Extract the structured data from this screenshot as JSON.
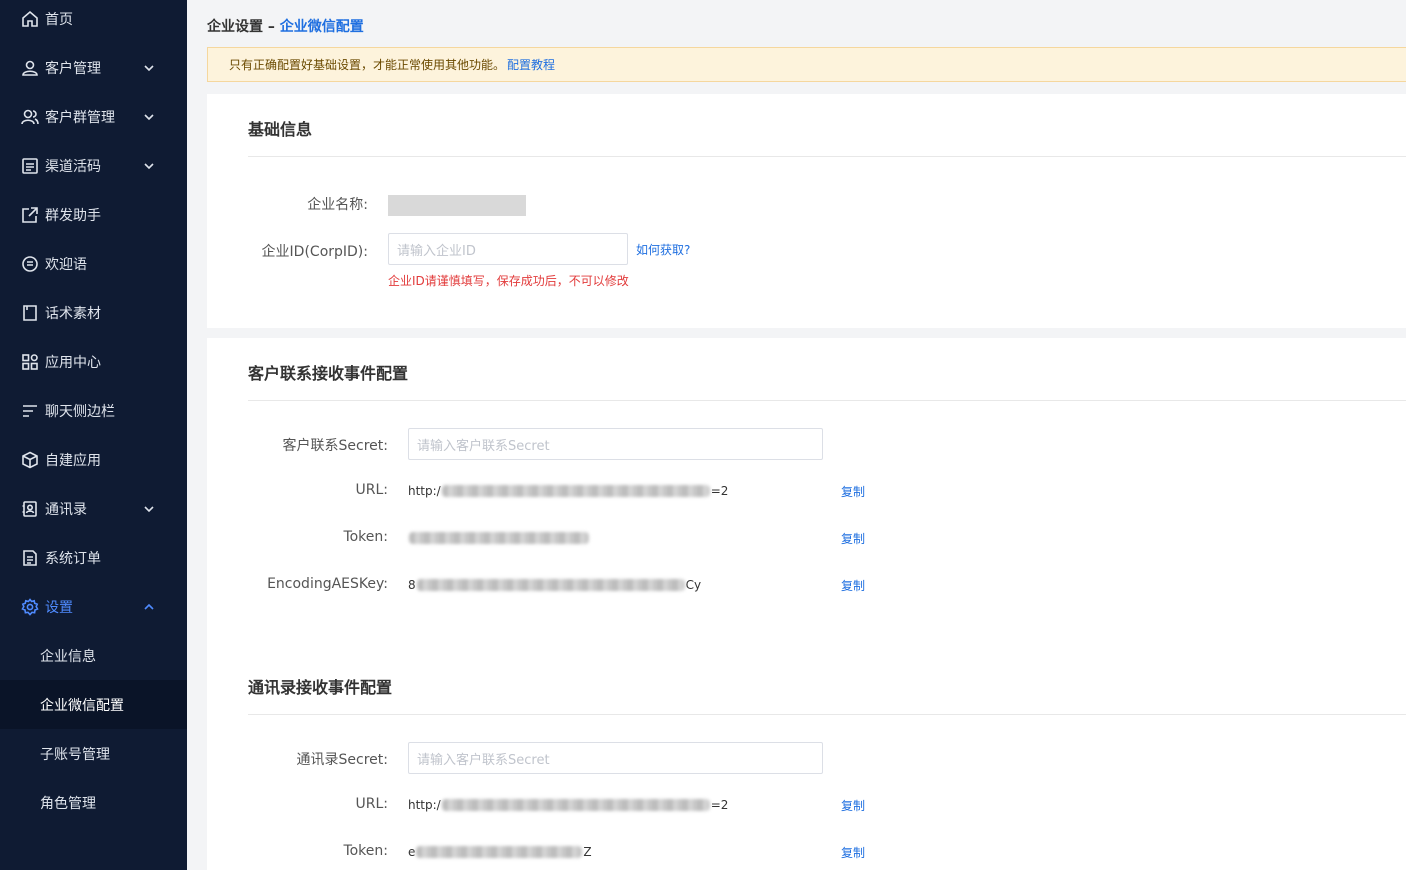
{
  "sidebar": {
    "items": [
      {
        "label": "首页",
        "icon": "home-icon"
      },
      {
        "label": "客户管理",
        "icon": "user-icon"
      },
      {
        "label": "客户群管理",
        "icon": "group-icon"
      },
      {
        "label": "渠道活码",
        "icon": "qrcode-icon"
      },
      {
        "label": "群发助手",
        "icon": "share-icon"
      },
      {
        "label": "欢迎语",
        "icon": "message-icon"
      },
      {
        "label": "话术素材",
        "icon": "book-icon"
      },
      {
        "label": "应用中心",
        "icon": "apps-icon"
      },
      {
        "label": "聊天侧边栏",
        "icon": "list-icon"
      },
      {
        "label": "自建应用",
        "icon": "box-icon"
      },
      {
        "label": "通讯录",
        "icon": "contacts-icon"
      },
      {
        "label": "系统订单",
        "icon": "order-icon"
      },
      {
        "label": "设置",
        "icon": "gear-icon"
      }
    ],
    "sub_items": [
      {
        "label": "企业信息"
      },
      {
        "label": "企业微信配置"
      },
      {
        "label": "子账号管理"
      },
      {
        "label": "角色管理"
      }
    ]
  },
  "breadcrumb": {
    "parent": "企业设置",
    "separator": " – ",
    "current": "企业微信配置"
  },
  "notice": {
    "text": "只有正确配置好基础设置，才能正常使用其他功能。",
    "link": "配置教程"
  },
  "basic": {
    "title": "基础信息",
    "name_label": "企业名称:",
    "corpid_label": "企业ID(CorpID):",
    "corpid_placeholder": "请输入企业ID",
    "corpid_help": "如何获取?",
    "corpid_warning": "企业ID请谨慎填写，保存成功后，不可以修改"
  },
  "customer_event": {
    "title": "客户联系接收事件配置",
    "secret_label": "客户联系Secret:",
    "secret_placeholder": "请输入客户联系Secret",
    "url_label": "URL:",
    "url_prefix": "http:/",
    "url_suffix": "=2",
    "token_label": "Token:",
    "aes_label": "EncodingAESKey:",
    "aes_prefix": "8",
    "aes_suffix": "Cy",
    "copy": "复制"
  },
  "contacts_event": {
    "title": "通讯录接收事件配置",
    "secret_label": "通讯录Secret:",
    "secret_placeholder": "请输入客户联系Secret",
    "url_label": "URL:",
    "url_prefix": "http:/",
    "url_suffix": "=2",
    "token_label": "Token:",
    "token_prefix": "e",
    "token_suffix": "Z",
    "copy": "复制"
  }
}
